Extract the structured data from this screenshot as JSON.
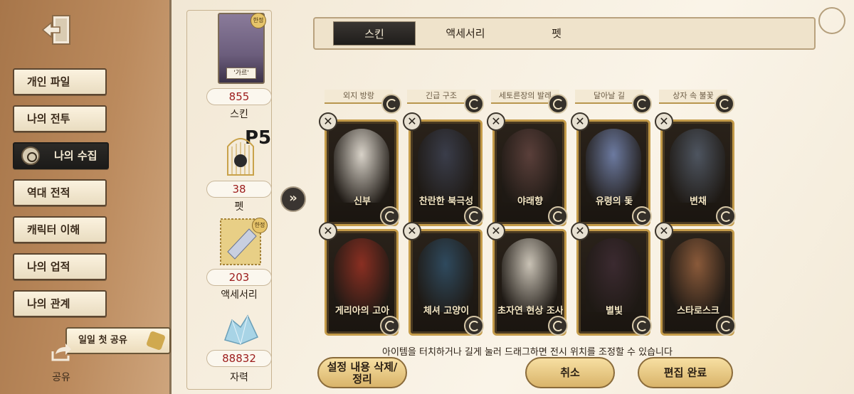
{
  "sidebar": {
    "items": [
      {
        "label": "개인 파일"
      },
      {
        "label": "나의 전투"
      },
      {
        "label": "나의 수집"
      },
      {
        "label": "역대 전적"
      },
      {
        "label": "캐릭터 이해"
      },
      {
        "label": "나의 업적"
      },
      {
        "label": "나의 관계"
      }
    ],
    "active_index": 2,
    "daily_share": "일일 첫 공유",
    "share_label": "공유"
  },
  "stats": {
    "skin_tag": "'가르'",
    "limited_badge": "한정",
    "skin_count": "855",
    "skin_label": "스킨",
    "pet_count": "38",
    "pet_label": "펫",
    "accessory_count": "203",
    "accessory_label": "액세서리",
    "currency_count": "88832",
    "currency_label": "자력",
    "pet_logo_text": "P5"
  },
  "tabs": [
    {
      "label": "스킨",
      "active": true
    },
    {
      "label": "액세서리",
      "active": false
    },
    {
      "label": "펫",
      "active": false
    }
  ],
  "peek_row": [
    "외지 방랑",
    "긴급 구조",
    "세토른장의 발레",
    "달아날 길",
    "상자 속 불꽃"
  ],
  "cards": [
    {
      "name": "신부",
      "color": "#d8d2c8"
    },
    {
      "name": "찬란한 북극성",
      "color": "#3a3d4a"
    },
    {
      "name": "야래향",
      "color": "#5a3f3a"
    },
    {
      "name": "유령의 돛",
      "color": "#6c7aa0"
    },
    {
      "name": "변채",
      "color": "#4e5560"
    },
    {
      "name": "게리아의 고아",
      "color": "#8a2f22"
    },
    {
      "name": "체셔 고양이",
      "color": "#2f4a5e"
    },
    {
      "name": "초자연 현상 조사원",
      "color": "#c9c2b5"
    },
    {
      "name": "별빛",
      "color": "#3b2a30"
    },
    {
      "name": "스타로스크",
      "color": "#8a5a3a"
    }
  ],
  "hint": "아이템을 터치하거나 길게 눌러 드래그하면 전시 위치를 조정할 수 있습니다",
  "buttons": {
    "clear": "설정 내용 삭제/\n정리",
    "clear_line1": "설정 내용 삭제/",
    "clear_line2": "정리",
    "cancel": "취소",
    "done": "편집 완료"
  },
  "colors": {
    "accent_gold": "#c49b49",
    "count_red": "#9c1c1c",
    "active_dark": "#1f1d1b"
  },
  "icons": [
    "exit-icon",
    "settings-emblem-icon",
    "puzzle-icon",
    "share-icon",
    "remove-icon",
    "swap-icon",
    "chevron-double-right-icon"
  ]
}
